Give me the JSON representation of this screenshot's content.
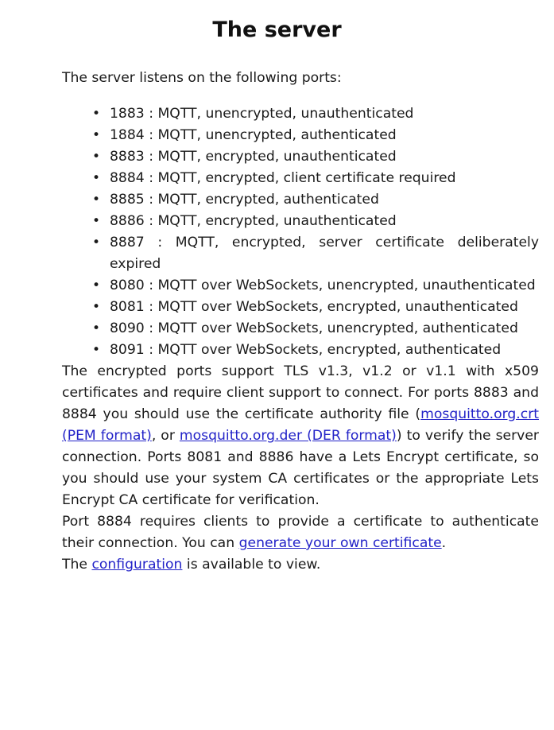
{
  "title": "The server",
  "intro": "The server listens on the following ports:",
  "ports": [
    "1883 : MQTT, unencrypted, unauthenticated",
    "1884 : MQTT, unencrypted, authenticated",
    "8883 : MQTT, encrypted, unauthenticated",
    "8884 : MQTT, encrypted, client certificate required",
    "8885 : MQTT, encrypted, authenticated",
    "8886 : MQTT, encrypted, unauthenticated",
    "8887 : MQTT, encrypted, server certificate deliberately expired",
    "8080 : MQTT over WebSockets, unencrypted, unauthenticated",
    "8081 : MQTT over WebSockets, encrypted, unauthenticated",
    "8090 : MQTT over WebSockets, unencrypted, authenticated",
    "8091 : MQTT over WebSockets, encrypted, authenticated"
  ],
  "tls_paragraph": {
    "text_before": "The encrypted ports support TLS v1.3, v1.2 or v1.1 with x509 certificates and require client support to connect. For ports 8883 and 8884 you should use the certificate authority file (",
    "link_crt": "mosquitto.org.crt (PEM format)",
    "text_middle": ", or ",
    "link_der": "mosquitto.org.der (DER format)",
    "text_after": ") to verify the server connection. Ports 8081 and 8886 have a Lets Encrypt certificate, so you should use your system CA certificates or the appropriate Lets Encrypt CA certificate for verification."
  },
  "client_cert_paragraph": {
    "text_before": "Port 8884 requires clients to provide a certificate to authenticate their connection. You can ",
    "link": "generate your own certificate",
    "text_after": "."
  },
  "config_paragraph": {
    "text_before": "The ",
    "link": "configuration",
    "text_after": " is available to view."
  },
  "colors": {
    "link": "#2323c8",
    "text": "#1a1a1a"
  }
}
